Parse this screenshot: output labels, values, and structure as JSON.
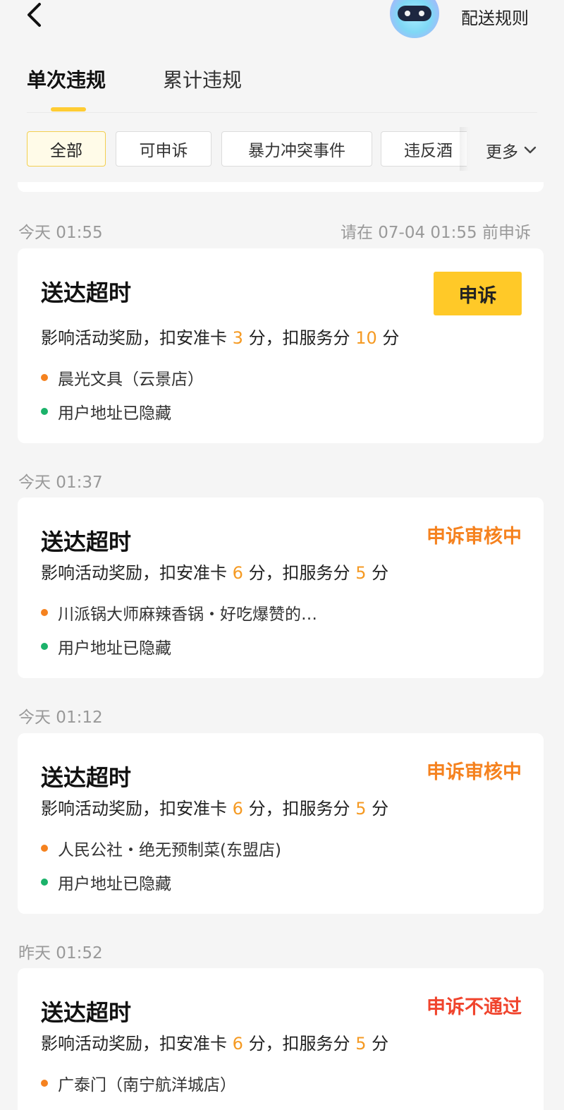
{
  "header": {
    "rules_link": "配送规则"
  },
  "tabs": [
    {
      "label": "单次违规",
      "active": true
    },
    {
      "label": "累计违规",
      "active": false
    }
  ],
  "filters": {
    "chips": [
      "全部",
      "可申诉",
      "暴力冲突事件",
      "违反酒"
    ],
    "selected": "全部",
    "more_label": "更多"
  },
  "records": [
    {
      "time": "今天 01:55",
      "deadline": "请在 07-04 01:55 前申诉",
      "title": "送达超时",
      "action": "申诉",
      "penalty_prefix": "影响活动奖励，扣安准卡",
      "card_points": "3",
      "penalty_mid": "分，扣服务分",
      "service_points": "10",
      "penalty_suffix": "分",
      "store": "晨光文具（云景店）",
      "address": "用户地址已隐藏"
    },
    {
      "time": "今天 01:37",
      "title": "送达超时",
      "status": "申诉审核中",
      "status_color": "#f5821f",
      "penalty_prefix": "影响活动奖励，扣安准卡",
      "card_points": "6",
      "penalty_mid": "分，扣服务分",
      "service_points": "5",
      "penalty_suffix": "分",
      "store": "川派锅大师麻辣香锅・好吃爆赞的…",
      "address": "用户地址已隐藏"
    },
    {
      "time": "今天 01:12",
      "title": "送达超时",
      "status": "申诉审核中",
      "status_color": "#f5821f",
      "penalty_prefix": "影响活动奖励，扣安准卡",
      "card_points": "6",
      "penalty_mid": "分，扣服务分",
      "service_points": "5",
      "penalty_suffix": "分",
      "store": "人民公社・绝无预制菜(东盟店)",
      "address": "用户地址已隐藏"
    },
    {
      "time": "昨天 01:52",
      "title": "送达超时",
      "status": "申诉不通过",
      "status_color": "#f0442d",
      "penalty_prefix": "影响活动奖励，扣安准卡",
      "card_points": "6",
      "penalty_mid": "分，扣服务分",
      "service_points": "5",
      "penalty_suffix": "分",
      "store": "广泰门（南宁航洋城店）",
      "address": "用户地址已隐藏"
    }
  ],
  "colors": {
    "accent": "#ffc928",
    "points": "#f59a23",
    "store_dot": "#f5821f",
    "address_dot": "#1bb26a"
  }
}
